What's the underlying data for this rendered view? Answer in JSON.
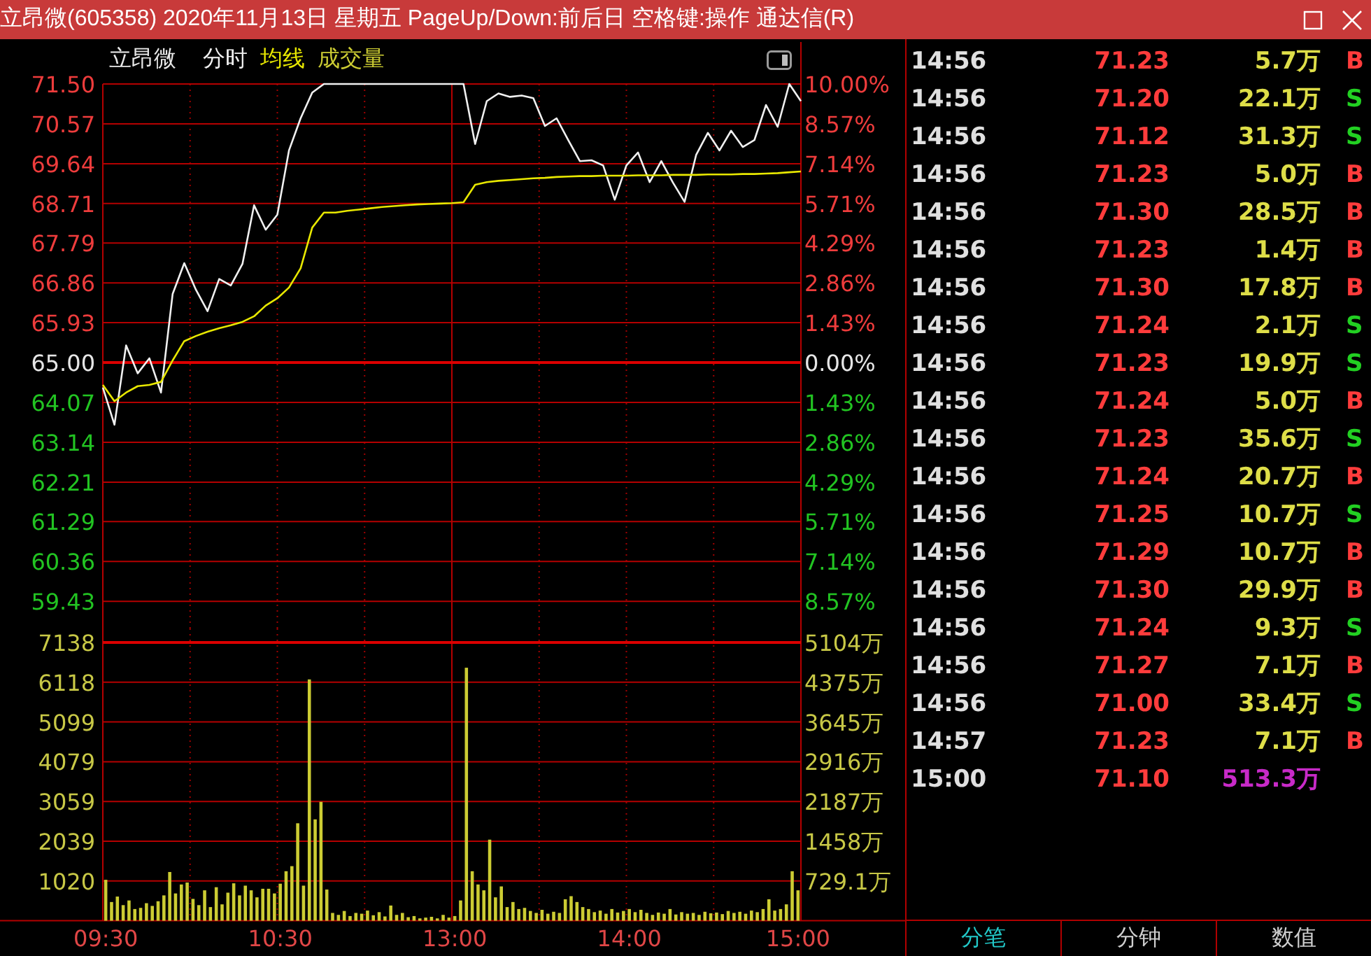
{
  "title_bar": {
    "title": "立昂微(605358) 2020年11月13日 星期五 PageUp/Down:前后日 空格键:操作 通达信(R)"
  },
  "chart_header": {
    "stock_name": "立昂微"
  },
  "price_chart": {
    "change_axis": [
      {
        "label": "10.00%",
        "kind": "up"
      },
      {
        "label": "8.57%",
        "kind": "up"
      },
      {
        "label": "7.14%",
        "kind": "up"
      },
      {
        "label": "5.71%",
        "kind": "up"
      },
      {
        "label": "4.29%",
        "kind": "up"
      },
      {
        "label": "2.86%",
        "kind": "up"
      },
      {
        "label": "1.43%",
        "kind": "up"
      },
      {
        "label": "0.00%",
        "kind": "flat"
      },
      {
        "label": "1.43%",
        "kind": "down"
      },
      {
        "label": "2.86%",
        "kind": "down"
      },
      {
        "label": "4.29%",
        "kind": "down"
      },
      {
        "label": "5.71%",
        "kind": "down"
      },
      {
        "label": "7.14%",
        "kind": "down"
      },
      {
        "label": "8.57%",
        "kind": "down"
      }
    ],
    "chart_data": {
      "type": "line",
      "grid": true,
      "categories": [
        null,
        null,
        null,
        null,
        null,
        null,
        null,
        null,
        null,
        null,
        null,
        null,
        null,
        null,
        null,
        null,
        null,
        null,
        null,
        null,
        null,
        null,
        null,
        null,
        null,
        null,
        null,
        null,
        null,
        null,
        null,
        null,
        null,
        null,
        null,
        null,
        null,
        null,
        null,
        null,
        null,
        null,
        null,
        null,
        null,
        null,
        null,
        null,
        null,
        null,
        null,
        null,
        null,
        null,
        null,
        null,
        null,
        null,
        null,
        null,
        null
      ],
      "ylim": [
        59.43,
        71.5
      ],
      "yticks": [
        {
          "value": 71.5,
          "label": "71.50"
        },
        {
          "value": 70.57,
          "label": "70.57"
        },
        {
          "value": 69.64,
          "label": "69.64"
        },
        {
          "value": 68.71,
          "label": "68.71"
        },
        {
          "value": 67.79,
          "label": "67.79"
        },
        {
          "value": 66.86,
          "label": "66.86"
        },
        {
          "value": 65.93,
          "label": "65.93"
        },
        {
          "value": 65,
          "label": "65.00"
        },
        {
          "value": 64.07,
          "label": "64.07"
        },
        {
          "value": 63.14,
          "label": "63.14"
        },
        {
          "value": 62.21,
          "label": "62.21"
        },
        {
          "value": 61.29,
          "label": "61.29"
        },
        {
          "value": 60.36,
          "label": "60.36"
        },
        {
          "value": 59.43,
          "label": "59.43"
        }
      ],
      "ref_lines": [
        {
          "axis": "y",
          "value": 65
        }
      ],
      "series": [
        {
          "name": "分时",
          "color": "#f0f0f0",
          "values": [
            64.42,
            63.55,
            65.4,
            64.75,
            65.1,
            64.3,
            66.6,
            67.32,
            66.7,
            66.2,
            66.95,
            66.8,
            67.3,
            68.67,
            68.1,
            68.45,
            69.95,
            70.7,
            71.3,
            71.5,
            71.5,
            71.5,
            71.5,
            71.5,
            71.5,
            71.5,
            71.5,
            71.5,
            71.5,
            71.5,
            71.5,
            71.5,
            70.1,
            71.1,
            71.28,
            71.2,
            71.23,
            71.17,
            70.52,
            70.7,
            70.19,
            69.7,
            69.72,
            69.6,
            68.8,
            69.6,
            69.9,
            69.21,
            69.7,
            69.2,
            68.75,
            69.85,
            70.36,
            69.95,
            70.41,
            70.03,
            70.19,
            71.01,
            70.5,
            71.5,
            71.1
          ]
        },
        {
          "name": "均线",
          "color": "#e8e800",
          "values": [
            64.48,
            64.1,
            64.3,
            64.45,
            64.48,
            64.55,
            65.05,
            65.5,
            65.62,
            65.72,
            65.8,
            65.87,
            65.95,
            66.08,
            66.33,
            66.5,
            66.75,
            67.2,
            68.15,
            68.5,
            68.5,
            68.54,
            68.57,
            68.6,
            68.63,
            68.65,
            68.67,
            68.69,
            68.7,
            68.71,
            68.72,
            68.74,
            69.15,
            69.21,
            69.24,
            69.26,
            69.28,
            69.3,
            69.31,
            69.33,
            69.34,
            69.35,
            69.35,
            69.36,
            69.36,
            69.36,
            69.37,
            69.37,
            69.37,
            69.38,
            69.38,
            69.38,
            69.39,
            69.39,
            69.39,
            69.4,
            69.4,
            69.41,
            69.42,
            69.44,
            69.46
          ]
        }
      ]
    }
  },
  "volume_chart": {
    "amount_axis": [
      "5104万",
      "4375万",
      "3645万",
      "2916万",
      "2187万",
      "1458万",
      "729.1万"
    ],
    "chart_data": {
      "type": "bar",
      "grid": true,
      "ylim": [
        0,
        7138
      ],
      "yticks": [
        7138,
        6118,
        5099,
        4079,
        3059,
        2039,
        1020
      ],
      "categories": [
        "09:30",
        null,
        null,
        null,
        null,
        null,
        null,
        null,
        null,
        null,
        null,
        null,
        null,
        null,
        null,
        null,
        null,
        null,
        null,
        null,
        null,
        null,
        null,
        null,
        null,
        null,
        null,
        null,
        null,
        null,
        "10:30",
        null,
        null,
        null,
        null,
        null,
        null,
        null,
        null,
        null,
        null,
        null,
        null,
        null,
        null,
        null,
        null,
        null,
        null,
        null,
        null,
        null,
        null,
        null,
        null,
        null,
        null,
        null,
        null,
        null,
        "13:00",
        null,
        null,
        null,
        null,
        null,
        null,
        null,
        null,
        null,
        null,
        null,
        null,
        null,
        null,
        null,
        null,
        null,
        null,
        null,
        null,
        null,
        null,
        null,
        null,
        null,
        null,
        null,
        null,
        null,
        "14:00",
        null,
        null,
        null,
        null,
        null,
        null,
        null,
        null,
        null,
        null,
        null,
        null,
        null,
        null,
        null,
        null,
        null,
        null,
        null,
        null,
        null,
        null,
        null,
        null,
        null,
        null,
        null,
        null,
        "15:00"
      ],
      "series": [
        {
          "name": "成交量",
          "color": "#cccc33",
          "values": [
            1050,
            480,
            620,
            400,
            520,
            300,
            330,
            450,
            380,
            500,
            650,
            1250,
            700,
            930,
            980,
            560,
            400,
            780,
            350,
            860,
            420,
            720,
            960,
            650,
            900,
            780,
            600,
            820,
            820,
            700,
            950,
            1270,
            1400,
            2500,
            900,
            6190,
            2600,
            3050,
            800,
            200,
            150,
            250,
            120,
            200,
            180,
            260,
            140,
            220,
            110,
            390,
            150,
            200,
            90,
            120,
            60,
            80,
            100,
            60,
            150,
            80,
            120,
            520,
            6490,
            1270,
            930,
            780,
            2080,
            600,
            880,
            350,
            480,
            300,
            330,
            250,
            200,
            280,
            180,
            230,
            200,
            550,
            630,
            480,
            350,
            300,
            220,
            260,
            180,
            300,
            210,
            250,
            300,
            220,
            280,
            200,
            150,
            210,
            180,
            300,
            160,
            220,
            180,
            200,
            150,
            230,
            190,
            210,
            170,
            250,
            200,
            230,
            180,
            260,
            220,
            300,
            550,
            260,
            300,
            420,
            1270,
            780
          ]
        }
      ]
    }
  },
  "trades": [
    {
      "time": "14:56",
      "price": "71.23",
      "volume": "5.7万",
      "side": "B",
      "color": "#ff3c3c",
      "kind": "trade"
    },
    {
      "time": "14:56",
      "price": "71.20",
      "volume": "22.1万",
      "side": "S",
      "color": "#22d022",
      "kind": "trade"
    },
    {
      "time": "14:56",
      "price": "71.12",
      "volume": "31.3万",
      "side": "S",
      "color": "#22d022",
      "kind": "trade"
    },
    {
      "time": "14:56",
      "price": "71.23",
      "volume": "5.0万",
      "side": "B",
      "color": "#ff3c3c",
      "kind": "trade"
    },
    {
      "time": "14:56",
      "price": "71.30",
      "volume": "28.5万",
      "side": "B",
      "color": "#ff3c3c",
      "kind": "trade"
    },
    {
      "time": "14:56",
      "price": "71.23",
      "volume": "1.4万",
      "side": "B",
      "color": "#ff3c3c",
      "kind": "trade"
    },
    {
      "time": "14:56",
      "price": "71.30",
      "volume": "17.8万",
      "side": "B",
      "color": "#ff3c3c",
      "kind": "trade"
    },
    {
      "time": "14:56",
      "price": "71.24",
      "volume": "2.1万",
      "side": "S",
      "color": "#22d022",
      "kind": "trade"
    },
    {
      "time": "14:56",
      "price": "71.23",
      "volume": "19.9万",
      "side": "S",
      "color": "#22d022",
      "kind": "trade"
    },
    {
      "time": "14:56",
      "price": "71.24",
      "volume": "5.0万",
      "side": "B",
      "color": "#ff3c3c",
      "kind": "trade"
    },
    {
      "time": "14:56",
      "price": "71.23",
      "volume": "35.6万",
      "side": "S",
      "color": "#22d022",
      "kind": "trade"
    },
    {
      "time": "14:56",
      "price": "71.24",
      "volume": "20.7万",
      "side": "B",
      "color": "#ff3c3c",
      "kind": "trade"
    },
    {
      "time": "14:56",
      "price": "71.25",
      "volume": "10.7万",
      "side": "S",
      "color": "#22d022",
      "kind": "trade"
    },
    {
      "time": "14:56",
      "price": "71.29",
      "volume": "10.7万",
      "side": "B",
      "color": "#ff3c3c",
      "kind": "trade"
    },
    {
      "time": "14:56",
      "price": "71.30",
      "volume": "29.9万",
      "side": "B",
      "color": "#ff3c3c",
      "kind": "trade"
    },
    {
      "time": "14:56",
      "price": "71.24",
      "volume": "9.3万",
      "side": "S",
      "color": "#22d022",
      "kind": "trade"
    },
    {
      "time": "14:56",
      "price": "71.27",
      "volume": "7.1万",
      "side": "B",
      "color": "#ff3c3c",
      "kind": "trade"
    },
    {
      "time": "14:56",
      "price": "71.00",
      "volume": "33.4万",
      "side": "S",
      "color": "#22d022",
      "kind": "trade"
    },
    {
      "time": "14:57",
      "price": "71.23",
      "volume": "7.1万",
      "side": "B",
      "color": "#ff3c3c",
      "kind": "trade"
    },
    {
      "time": "15:00",
      "price": "71.10",
      "volume": "513.3万",
      "kind": "auction"
    }
  ],
  "bottom_tabs": [
    {
      "label": "分笔",
      "selected": true
    },
    {
      "label": "分钟",
      "selected": false
    },
    {
      "label": "数值",
      "selected": false
    }
  ]
}
